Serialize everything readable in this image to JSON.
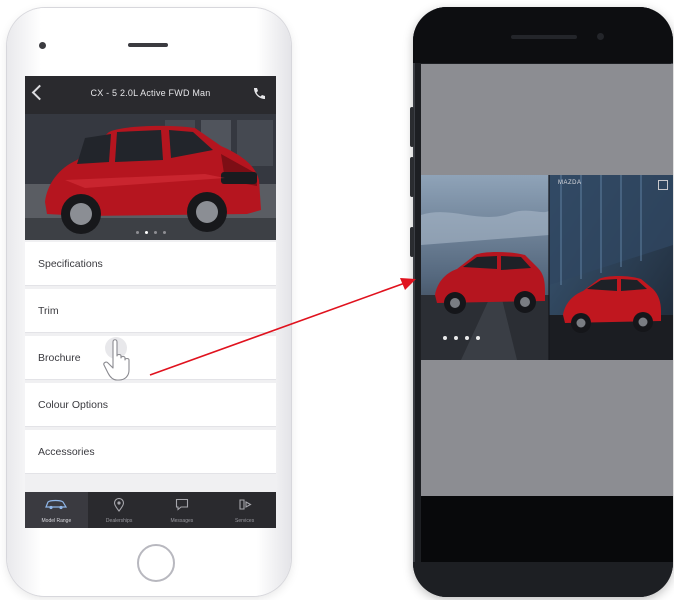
{
  "left_phone": {
    "header": {
      "title": "CX - 5 2.0L Active FWD Man"
    },
    "hero": {
      "slide_count": 4,
      "active_slide": 2
    },
    "menu": [
      {
        "label": "Specifications"
      },
      {
        "label": "Trim"
      },
      {
        "label": "Brochure"
      },
      {
        "label": "Colour Options"
      },
      {
        "label": "Accessories"
      }
    ],
    "tabs": [
      {
        "label": "Model Range",
        "icon": "car-icon",
        "active": true
      },
      {
        "label": "Dealerships",
        "icon": "pin-icon",
        "active": false
      },
      {
        "label": "Messages",
        "icon": "chat-icon",
        "active": false
      },
      {
        "label": "Services",
        "icon": "service-icon",
        "active": false
      }
    ]
  },
  "right_phone": {
    "brochure": {
      "page_label": "MAZDA",
      "page_count": 4
    }
  },
  "colors": {
    "accent_red": "#e0121e",
    "car_red": "#b5151f",
    "header_dark": "#2a2a2e"
  }
}
